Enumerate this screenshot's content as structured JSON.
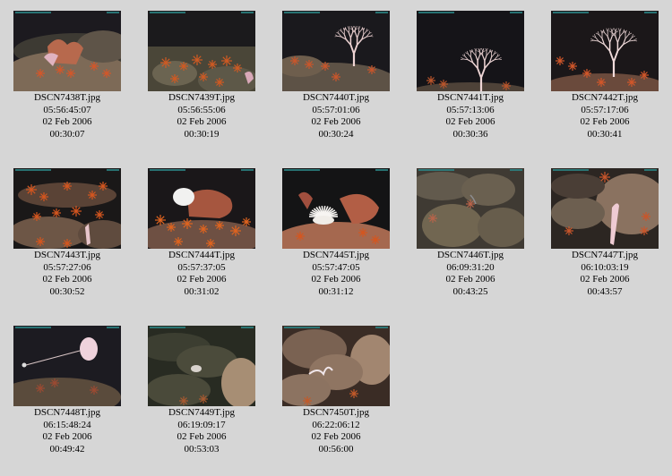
{
  "thumbnails": [
    {
      "filename": "DSCN7438T.jpg",
      "clock": "05:56:45:07",
      "date": "02 Feb 2006",
      "elapsed": "00:30:07",
      "scene": "orange-corals-left"
    },
    {
      "filename": "DSCN7439T.jpg",
      "clock": "05:56:55:06",
      "date": "02 Feb 2006",
      "elapsed": "00:30:19",
      "scene": "rubble-starfish"
    },
    {
      "filename": "DSCN7440T.jpg",
      "clock": "05:57:01:06",
      "date": "02 Feb 2006",
      "elapsed": "00:30:24",
      "scene": "white-fan-right"
    },
    {
      "filename": "DSCN7441T.jpg",
      "clock": "05:57:13:06",
      "date": "02 Feb 2006",
      "elapsed": "00:30:36",
      "scene": "white-fan-low"
    },
    {
      "filename": "DSCN7442T.jpg",
      "clock": "05:57:17:06",
      "date": "02 Feb 2006",
      "elapsed": "00:30:41",
      "scene": "white-fan-big"
    },
    {
      "filename": "DSCN7443T.jpg",
      "clock": "05:57:27:06",
      "date": "02 Feb 2006",
      "elapsed": "00:30:52",
      "scene": "starfish-field"
    },
    {
      "filename": "DSCN7444T.jpg",
      "clock": "05:57:37:05",
      "date": "02 Feb 2006",
      "elapsed": "00:31:02",
      "scene": "white-sponge-corals"
    },
    {
      "filename": "DSCN7445T.jpg",
      "clock": "05:57:47:05",
      "date": "02 Feb 2006",
      "elapsed": "00:31:12",
      "scene": "white-anemone"
    },
    {
      "filename": "DSCN7446T.jpg",
      "clock": "06:09:31:20",
      "date": "02 Feb 2006",
      "elapsed": "00:43:25",
      "scene": "gray-rocks"
    },
    {
      "filename": "DSCN7447T.jpg",
      "clock": "06:10:03:19",
      "date": "02 Feb 2006",
      "elapsed": "00:43:57",
      "scene": "pink-stalk-rock"
    },
    {
      "filename": "DSCN7448T.jpg",
      "clock": "06:15:48:24",
      "date": "02 Feb 2006",
      "elapsed": "00:49:42",
      "scene": "glass-sponge"
    },
    {
      "filename": "DSCN7449T.jpg",
      "clock": "06:19:09:17",
      "date": "02 Feb 2006",
      "elapsed": "00:53:03",
      "scene": "boulder-field"
    },
    {
      "filename": "DSCN7450T.jpg",
      "clock": "06:22:06:12",
      "date": "02 Feb 2006",
      "elapsed": "00:56:00",
      "scene": "tan-boulders"
    }
  ],
  "colors": {
    "page_background": "#d6d6d6",
    "caption_text": "#000000"
  }
}
